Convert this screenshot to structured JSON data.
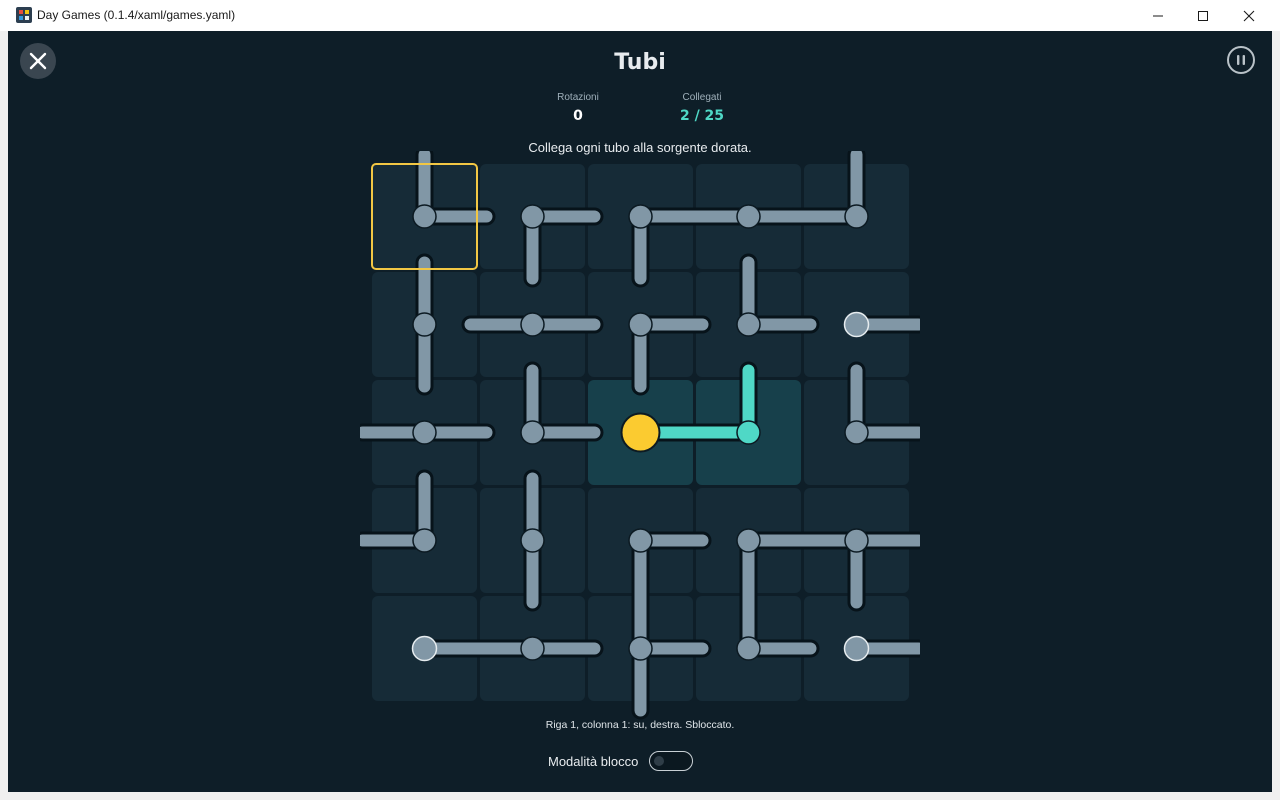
{
  "window": {
    "title": "Day Games (0.1.4/xaml/games.yaml)"
  },
  "game": {
    "title": "Tubi",
    "stats": {
      "rotations_label": "Rotazioni",
      "rotations_value": "0",
      "connected_label": "Collegati",
      "connected_value": "2 / 25"
    },
    "instruction": "Collega ogni tubo alla sorgente dorata.",
    "status": "Riga 1, colonna 1: su, destra. Sbloccato.",
    "lock_mode_label": "Modalità blocco",
    "lock_mode_on": false,
    "colors": {
      "background": "#0e1e28",
      "tile": "#162b37",
      "tile_connected": "#17404b",
      "pipe": "#8197a6",
      "pipe_connected": "#4fd8c6",
      "source": "#fbcb30",
      "selection": "#f2c744",
      "connected_value": "#4fd8c6"
    },
    "board": {
      "rows": 5,
      "cols": 5,
      "selected": [
        0,
        0
      ],
      "source": [
        2,
        2
      ],
      "tiles": [
        [
          {
            "conn": [
              "up",
              "right"
            ],
            "connected": false
          },
          {
            "conn": [
              "right",
              "down"
            ],
            "connected": false
          },
          {
            "conn": [
              "right",
              "down"
            ],
            "connected": false
          },
          {
            "conn": [
              "left",
              "right"
            ],
            "connected": false
          },
          {
            "conn": [
              "left",
              "up"
            ],
            "connected": false
          }
        ],
        [
          {
            "conn": [
              "up",
              "down"
            ],
            "connected": false
          },
          {
            "conn": [
              "left",
              "right"
            ],
            "connected": false
          },
          {
            "conn": [
              "right",
              "down"
            ],
            "connected": false
          },
          {
            "conn": [
              "up",
              "right"
            ],
            "connected": false
          },
          {
            "conn": [
              "right"
            ],
            "connected": false,
            "endpoint": true
          }
        ],
        [
          {
            "conn": [
              "left",
              "right"
            ],
            "connected": false
          },
          {
            "conn": [
              "up",
              "right"
            ],
            "connected": false
          },
          {
            "conn": [
              "right"
            ],
            "connected": true,
            "source": true
          },
          {
            "conn": [
              "left",
              "up"
            ],
            "connected": true
          },
          {
            "conn": [
              "up",
              "right"
            ],
            "connected": false
          }
        ],
        [
          {
            "conn": [
              "left",
              "up"
            ],
            "connected": false
          },
          {
            "conn": [
              "up",
              "down"
            ],
            "connected": false
          },
          {
            "conn": [
              "right",
              "down"
            ],
            "connected": false
          },
          {
            "conn": [
              "right",
              "down"
            ],
            "connected": false
          },
          {
            "conn": [
              "left",
              "right",
              "down"
            ],
            "connected": false
          }
        ],
        [
          {
            "conn": [
              "right"
            ],
            "connected": false,
            "endpoint": true
          },
          {
            "conn": [
              "left",
              "right"
            ],
            "connected": false
          },
          {
            "conn": [
              "up",
              "right",
              "down"
            ],
            "connected": false
          },
          {
            "conn": [
              "up",
              "right"
            ],
            "connected": false
          },
          {
            "conn": [
              "right"
            ],
            "connected": false,
            "endpoint": true
          }
        ]
      ]
    }
  }
}
